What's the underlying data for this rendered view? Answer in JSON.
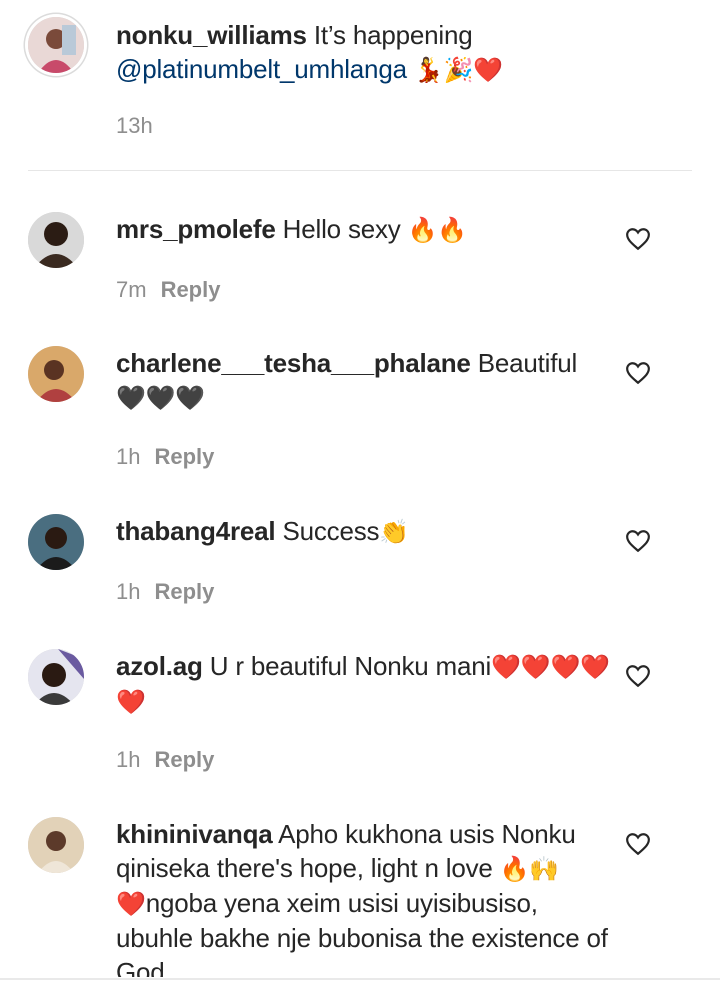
{
  "caption": {
    "username": "nonku_williams",
    "text": "It’s happening",
    "mention": "@platinumbelt_umhlanga",
    "emoji": "💃🎉❤️",
    "time": "13h"
  },
  "reply_label": "Reply",
  "comments": [
    {
      "username": "mrs_pmolefe",
      "text": "Hello sexy",
      "emoji": "🔥🔥",
      "time": "7m"
    },
    {
      "username": "charlene___tesha___phalane",
      "text": "Beautiful",
      "emoji": "🖤🖤🖤",
      "time": "1h"
    },
    {
      "username": "thabang4real",
      "text": "Success",
      "emoji": "👏",
      "time": "1h"
    },
    {
      "username": "azol.ag",
      "text": "U r beautiful Nonku mani",
      "emoji": "❤️❤️❤️❤️❤️",
      "time": "1h"
    },
    {
      "username": "khininivanqa",
      "text": "Apho kukhona usis Nonku qiniseka there's hope, light n love",
      "emoji": "🔥🙌",
      "text2_emoji": "❤️",
      "text2": "ngoba yena xeim usisi uyisibusiso, ubuhle bakhe nje bubonisa the existence of God"
    }
  ],
  "colors": {
    "text": "#262626",
    "meta": "#8e8e8e",
    "mention": "#00376b"
  }
}
